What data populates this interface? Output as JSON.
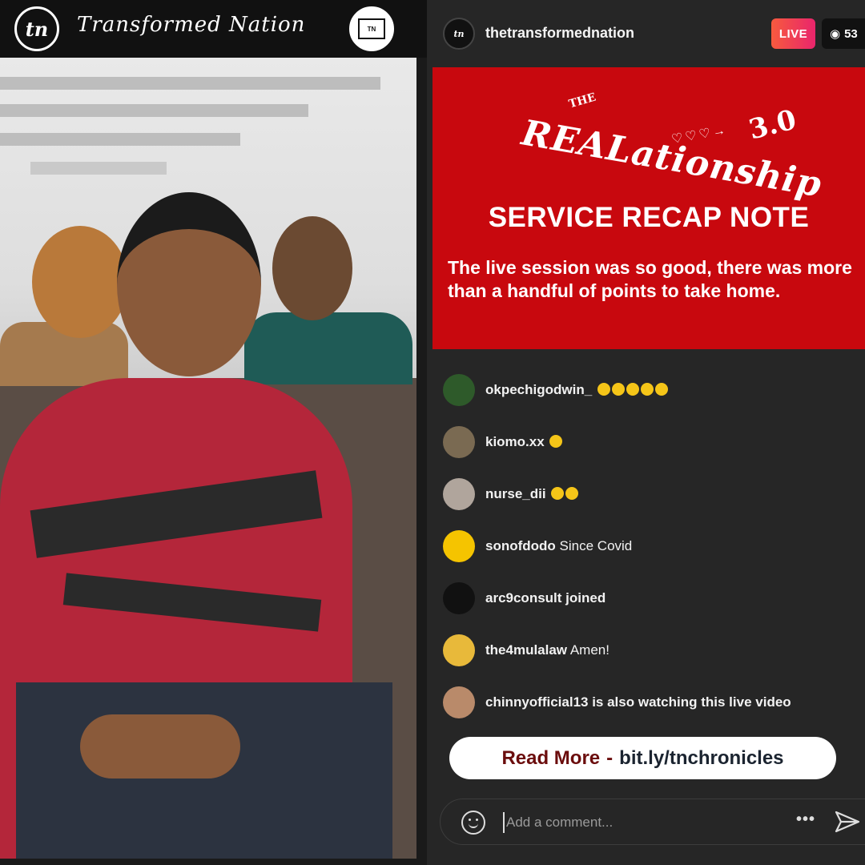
{
  "brand": {
    "logo_text": "tn",
    "name": "Transformed Nation",
    "badge_text": "TN"
  },
  "header": {
    "avatar_text": "tn",
    "username": "thetransformednation",
    "live_label": "LIVE",
    "viewer_count": "53"
  },
  "recap": {
    "logo_the": "THE",
    "logo_main": "REALationship",
    "logo_version": "3.0",
    "title": "SERVICE RECAP NOTE",
    "body": "The live session was so good, there was more than a handful of points to take home."
  },
  "comments": [
    {
      "user": "okpechigodwin_",
      "text": "",
      "emoji_count": 5,
      "avatar_color": "#2e5a2a"
    },
    {
      "user": "kiomo.xx",
      "text": "",
      "emoji_count": 1,
      "avatar_color": "#7a6a52"
    },
    {
      "user": "nurse_dii",
      "text": "",
      "emoji_count": 2,
      "avatar_color": "#b0a59c"
    },
    {
      "user": "sonofdodo",
      "text": "Since Covid",
      "emoji_count": 0,
      "avatar_color": "#f5c400"
    },
    {
      "user": "arc9consult joined",
      "text": "",
      "emoji_count": 0,
      "avatar_color": "#111111"
    },
    {
      "user": "the4mulalaw",
      "text": "Amen!",
      "emoji_count": 0,
      "avatar_color": "#e8b93a"
    },
    {
      "user": "chinnyofficial13 is also watching this live video",
      "text": "",
      "emoji_count": 0,
      "avatar_color": "#b98a6a"
    }
  ],
  "read_more": {
    "label": "Read More",
    "separator": "-",
    "url": "bit.ly/tnchronicles"
  },
  "comment_bar": {
    "placeholder": "Add a comment...",
    "more_label": "•••"
  },
  "colors": {
    "recap_red": "#c8080e",
    "panel_bg": "#262626",
    "live_gradient_start": "#f75a3e",
    "live_gradient_end": "#e9256c"
  }
}
